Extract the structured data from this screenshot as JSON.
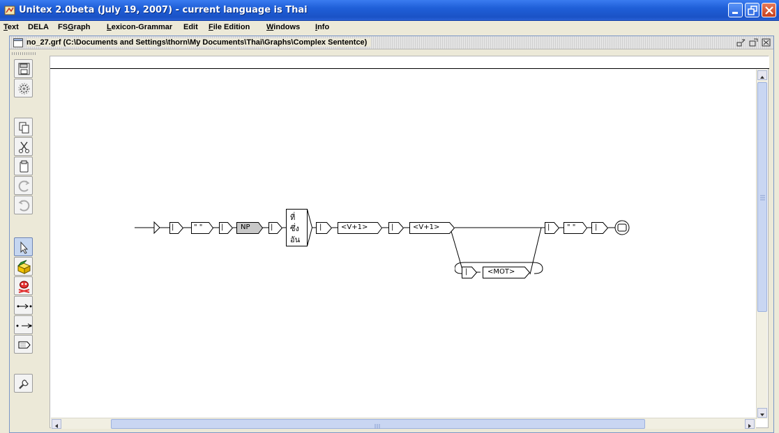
{
  "window": {
    "title": "Unitex 2.0beta (July 19, 2007) - current language is Thai"
  },
  "menu": {
    "items": [
      {
        "label": "Text",
        "mnemonic": "T",
        "rest": "ext"
      },
      {
        "label": "DELA",
        "mnemonic": "",
        "rest": "DELA"
      },
      {
        "label": "FSGraph",
        "pre": "FS",
        "mnemonic": "G",
        "rest": "raph"
      },
      {
        "label": "Lexicon-Grammar",
        "mnemonic": "L",
        "rest": "exicon-Grammar"
      },
      {
        "label": "Edit",
        "mnemonic": "",
        "rest": "Edit"
      },
      {
        "label": "File Edition",
        "mnemonic": "F",
        "rest": "ile Edition"
      },
      {
        "label": "Windows",
        "mnemonic": "W",
        "rest": "indows"
      },
      {
        "label": "Info",
        "mnemonic": "I",
        "rest": "nfo"
      }
    ]
  },
  "frame": {
    "title": "no_27.grf (C:\\Documents and Settings\\thorn\\My Documents\\Thai\\Graphs\\Complex Sententce)"
  },
  "toolbar": {
    "buttons": [
      {
        "name": "save-icon"
      },
      {
        "name": "compile-icon"
      },
      {
        "name": "copy-icon"
      },
      {
        "name": "cut-icon"
      },
      {
        "name": "paste-icon"
      },
      {
        "name": "redo-icon"
      },
      {
        "name": "undo-icon"
      },
      {
        "name": "arrow-select-icon",
        "selected": true
      },
      {
        "name": "open-box-icon"
      },
      {
        "name": "kill-entity-icon"
      },
      {
        "name": "link-forward-icon"
      },
      {
        "name": "link-backward-icon"
      },
      {
        "name": "open-subgraph-icon"
      },
      {
        "name": "configure-icon"
      }
    ]
  },
  "graph": {
    "boxes": {
      "b1": "|",
      "quote1": "\" \"",
      "b2": "|",
      "np": "NP",
      "b3": "|",
      "thai_line1": "ที่",
      "thai_line2": "ซึ่ง",
      "thai_line3": "อัน",
      "b4": "|",
      "v1": "<V+1>",
      "b5": "|",
      "v2": "<V+1>",
      "b6": "|",
      "quote2": "\" \"",
      "b7": "|",
      "b_loop": "|",
      "mot": "<MOT>"
    }
  },
  "colors": {
    "titlebar": "#1f5fd8",
    "canvas": "#ffffff",
    "scroll_thumb": "#c9d6f2"
  }
}
